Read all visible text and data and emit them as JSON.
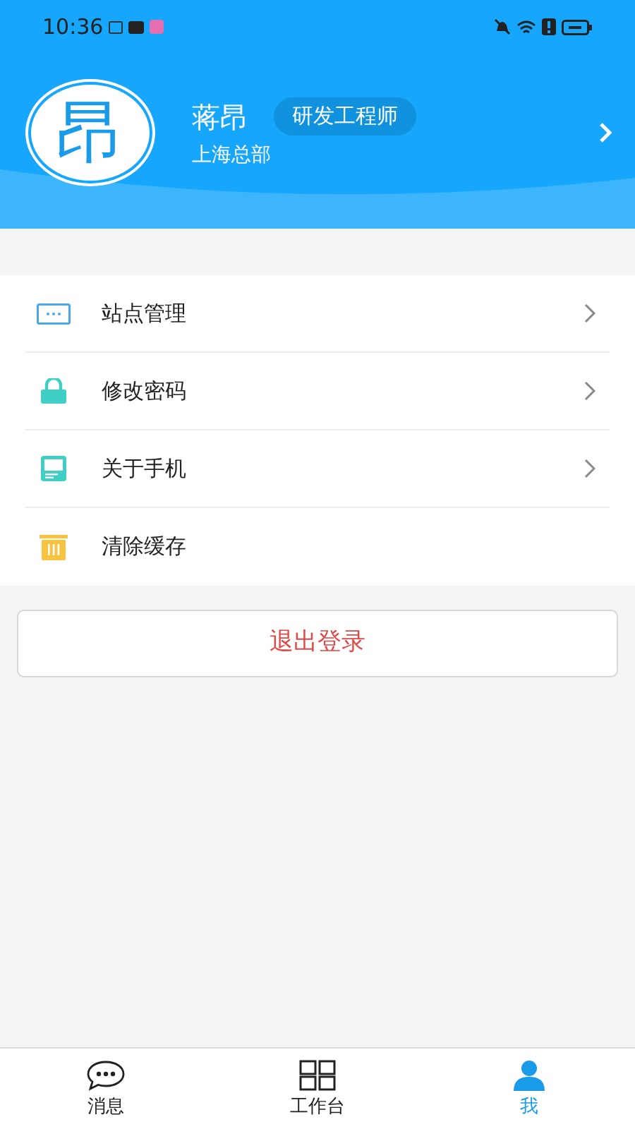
{
  "status_bar": {
    "time": "10:36"
  },
  "profile": {
    "avatar_text": "昂",
    "name": "蒋昂",
    "role": "研发工程师",
    "department": "上海总部"
  },
  "menu": [
    {
      "kind": "site",
      "label": "站点管理",
      "has_arrow": true
    },
    {
      "kind": "lock",
      "label": "修改密码",
      "has_arrow": true
    },
    {
      "kind": "phone",
      "label": "关于手机",
      "has_arrow": true
    },
    {
      "kind": "trash",
      "label": "清除缓存",
      "has_arrow": false
    }
  ],
  "logout": {
    "label": "退出登录"
  },
  "tabs": [
    {
      "kind": "chat",
      "label": "消息",
      "selected": false
    },
    {
      "kind": "grid",
      "label": "工作台",
      "selected": false
    },
    {
      "kind": "person",
      "label": "我",
      "selected": true
    }
  ]
}
